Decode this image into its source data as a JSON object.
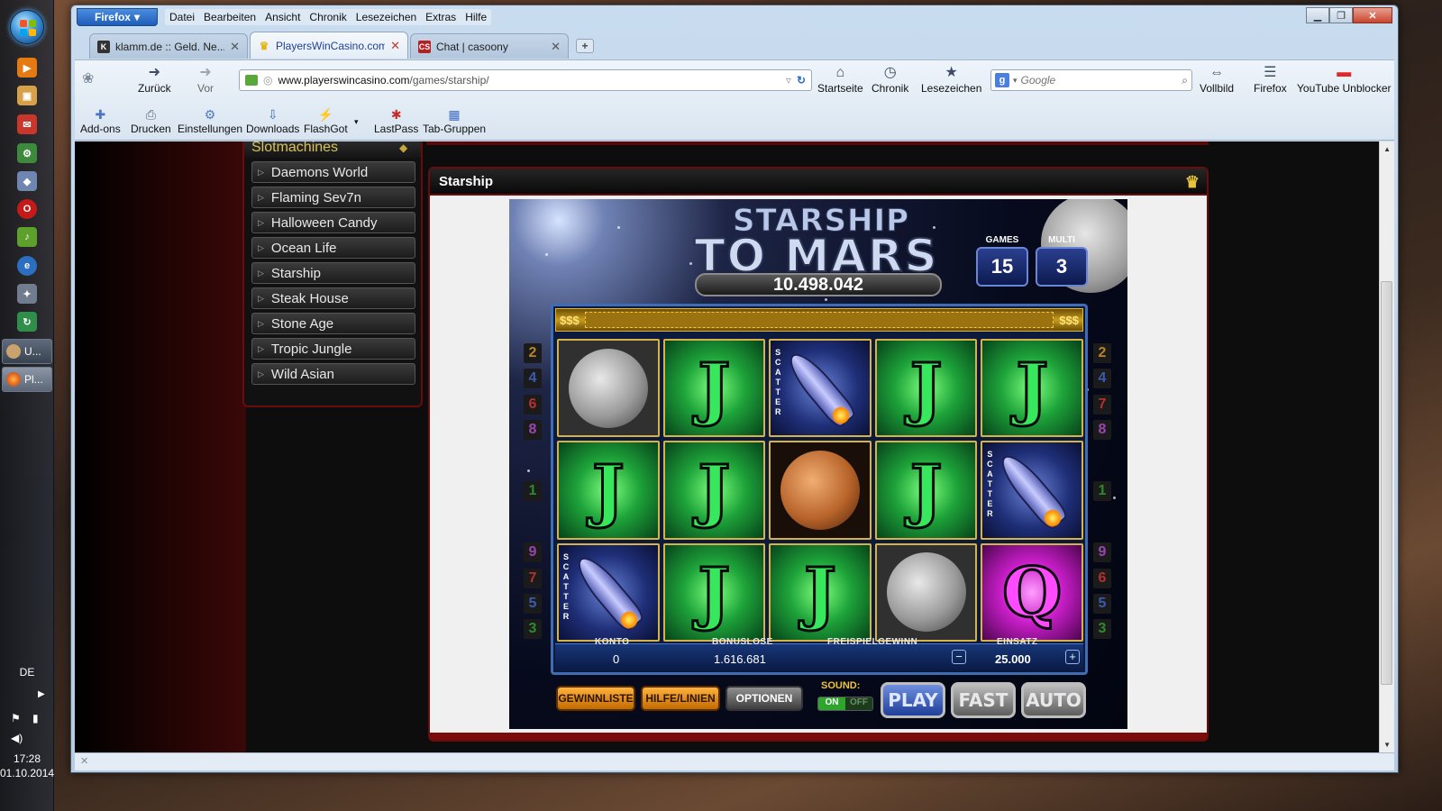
{
  "taskbar": {
    "language": "DE",
    "time": "17:28",
    "date": "01.10.2014",
    "tasks": [
      {
        "label": "U..."
      },
      {
        "label": "Pl..."
      }
    ]
  },
  "browser": {
    "app_button": "Firefox",
    "menu": [
      "Datei",
      "Bearbeiten",
      "Ansicht",
      "Chronik",
      "Lesezeichen",
      "Extras",
      "Hilfe"
    ],
    "tabs": [
      {
        "title": "klamm.de :: Geld. Ne..."
      },
      {
        "title": "PlayersWinCasino.com"
      },
      {
        "title": "Chat | casoony"
      }
    ],
    "new_tab_label": "+",
    "nav": {
      "back": "Zurück",
      "forward": "Vor",
      "url_domain": "www.playerswincasino.com",
      "url_path": "/games/starship/",
      "home": "Startseite",
      "history": "Chronik",
      "bookmarks": "Lesezeichen",
      "search_placeholder": "Google",
      "fullscreen": "Vollbild",
      "firefox": "Firefox",
      "youtube_unblocker": "YouTube Unblocker"
    },
    "bookmarks_bar": [
      "Add-ons",
      "Drucken",
      "Einstellungen",
      "Downloads",
      "FlashGot",
      "LastPass",
      "Tab-Gruppen"
    ]
  },
  "page": {
    "sidebar": {
      "heading": "Slotmachines",
      "games": [
        "Daemons World",
        "Flaming Sev7n",
        "Halloween Candy",
        "Ocean Life",
        "Starship",
        "Steak House",
        "Stone Age",
        "Tropic Jungle",
        "Wild Asian"
      ]
    },
    "panel_title": "Starship",
    "game": {
      "logo_line1": "STARSHIP",
      "logo_line2": "TO MARS",
      "jackpot": "10.498.042",
      "games_label": "GAMES",
      "games_value": "15",
      "multi_label": "MULTI",
      "multi_value": "3",
      "bonus_left": "$$$",
      "bonus_right": "$$$",
      "scatter_text": "SCATTER",
      "reels": [
        [
          "moon",
          "J",
          "rocket",
          "J",
          "J"
        ],
        [
          "J",
          "J",
          "mars",
          "J",
          "rocket"
        ],
        [
          "rocket",
          "J",
          "J",
          "moon",
          "Q"
        ]
      ],
      "left_lines": [
        "2",
        "4",
        "6",
        "8",
        "1",
        "9",
        "7",
        "5",
        "3"
      ],
      "right_lines": [
        "2",
        "4",
        "7",
        "8",
        "1",
        "9",
        "6",
        "5",
        "3"
      ],
      "line_colors": {
        "1": "#2e8a2e",
        "2": "#b8842a",
        "3": "#2e8a2e",
        "4": "#3a5bb0",
        "5": "#3a5bb0",
        "6": "#b53030",
        "7": "#b53030",
        "8": "#9b45b0",
        "9": "#9b45b0"
      },
      "info": {
        "konto_label": "KONTO",
        "konto_value": "0",
        "bonus_label": "BONUSLOSE",
        "bonus_value": "1.616.681",
        "freispiel_label": "FREISPIELGEWINN",
        "einsatz_label": "EINSATZ",
        "einsatz_value": "25.000",
        "minus": "−",
        "plus": "+"
      },
      "buttons": {
        "gewinnliste": "GEWINNLISTE",
        "hilfe": "HILFE/LINIEN",
        "optionen": "OPTIONEN",
        "sound_label": "SOUND:",
        "sound_on": "ON",
        "sound_off": "OFF",
        "play": "PLAY",
        "fast": "FAST",
        "auto": "AUTO"
      }
    }
  },
  "colors": {
    "accent_red": "#6b0b0b",
    "gold": "#d6b34a",
    "reel_blue": "#3e6db3",
    "tab_active_text": "#1f3f99"
  }
}
